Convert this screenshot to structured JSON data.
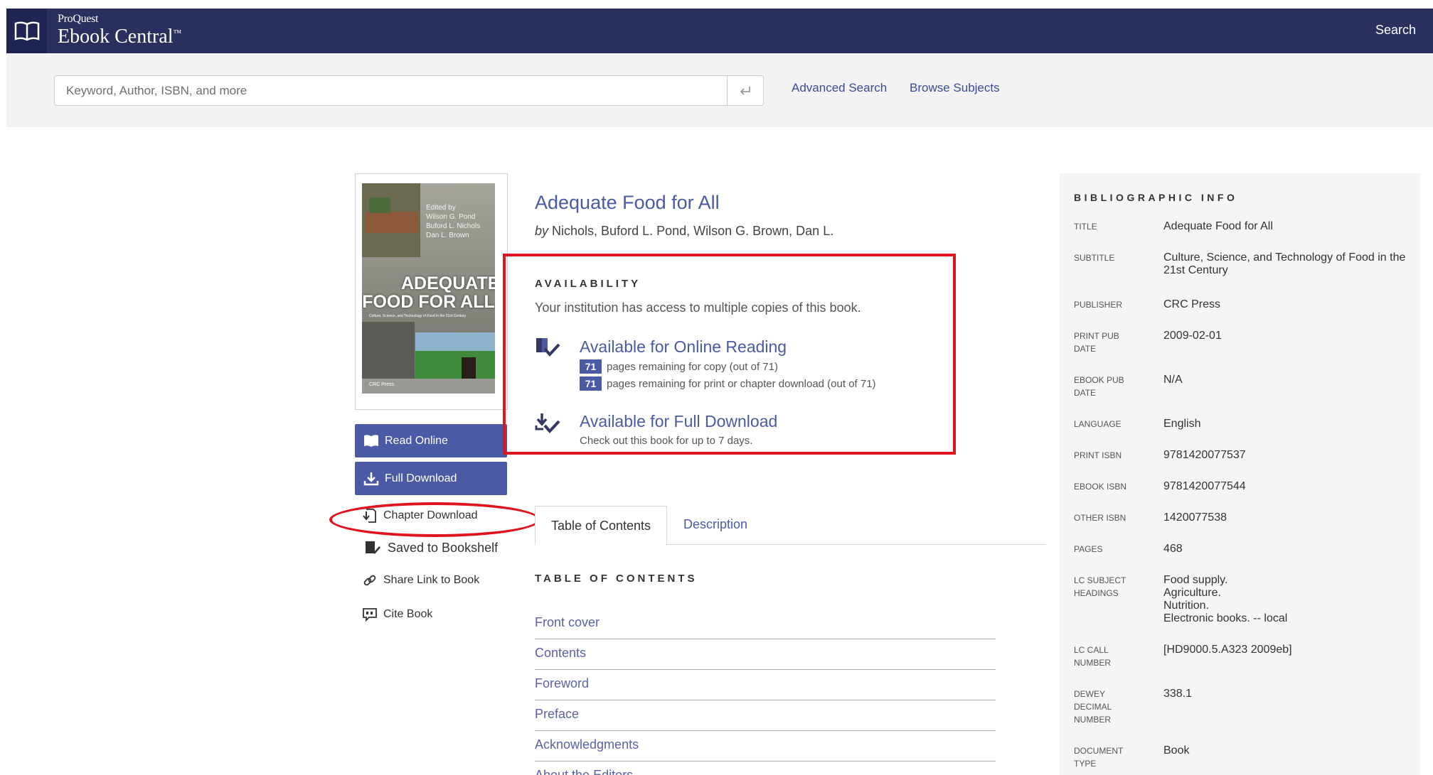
{
  "header": {
    "brand_small": "ProQuest",
    "brand_main": "Ebook Central",
    "brand_tm": "™",
    "search_link": "Search"
  },
  "search": {
    "placeholder": "Keyword, Author, ISBN, and more",
    "value": "",
    "advanced_link": "Advanced Search",
    "browse_link": "Browse Subjects"
  },
  "cover": {
    "editors": [
      "Edited by",
      "Wilson G. Pond",
      "Buford L. Nichols",
      "Dan L. Brown"
    ],
    "title_line1": "ADEQUATE",
    "title_line2": "FOOD FOR ALL",
    "subtitle": "Culture, Science, and Technology of Food in the 21st Century",
    "publisher_mark": "CRC Press"
  },
  "actions": {
    "read_online": "Read Online",
    "full_download": "Full Download",
    "chapter_download": "Chapter Download",
    "saved_bookshelf": "Saved to Bookshelf",
    "share_link": "Share Link to Book",
    "cite_book": "Cite Book"
  },
  "book": {
    "title": "Adequate Food for All",
    "by": "by",
    "authors": "Nichols, Buford L. Pond, Wilson G. Brown, Dan L."
  },
  "availability": {
    "heading": "AVAILABILITY",
    "summary": "Your institution has access to multiple copies of this book.",
    "online_title": "Available for Online Reading",
    "copy_pages": "71",
    "copy_text": "pages remaining for copy (out of 71)",
    "print_pages": "71",
    "print_text": "pages remaining for print or chapter download (out of 71)",
    "download_title": "Available for Full Download",
    "download_text": "Check out this book for up to 7 days."
  },
  "tabs": {
    "toc": "Table of Contents",
    "description": "Description"
  },
  "toc": {
    "heading": "TABLE OF CONTENTS",
    "items": [
      "Front cover",
      "Contents",
      "Foreword",
      "Preface",
      "Acknowledgments",
      "About the Editors"
    ]
  },
  "biblio": {
    "heading": "BIBLIOGRAPHIC INFO",
    "rows": [
      {
        "label": "TITLE",
        "value": "Adequate Food for All"
      },
      {
        "label": "SUBTITLE",
        "value": "Culture, Science, and Technology of Food in the 21st Century"
      },
      {
        "label": "PUBLISHER",
        "value": "CRC Press"
      },
      {
        "label": "PRINT PUB DATE",
        "value": "2009-02-01"
      },
      {
        "label": "EBOOK PUB DATE",
        "value": "N/A"
      },
      {
        "label": "LANGUAGE",
        "value": "English"
      },
      {
        "label": "PRINT ISBN",
        "value": "9781420077537"
      },
      {
        "label": "EBOOK ISBN",
        "value": "9781420077544"
      },
      {
        "label": "OTHER ISBN",
        "value": "1420077538"
      },
      {
        "label": "PAGES",
        "value": "468"
      },
      {
        "label": "LC SUBJECT HEADINGS",
        "value": [
          "Food supply.",
          "Agriculture.",
          "Nutrition.",
          "Electronic books. -- local"
        ]
      },
      {
        "label": "LC CALL NUMBER",
        "value": "[HD9000.5.A323 2009eb]"
      },
      {
        "label": "DEWEY DECIMAL NUMBER",
        "value": "338.1"
      },
      {
        "label": "DOCUMENT TYPE",
        "value": "Book"
      }
    ]
  },
  "colors": {
    "header_bg": "#29305e",
    "accent": "#4b5aa5",
    "highlight_red": "#e0141e"
  }
}
